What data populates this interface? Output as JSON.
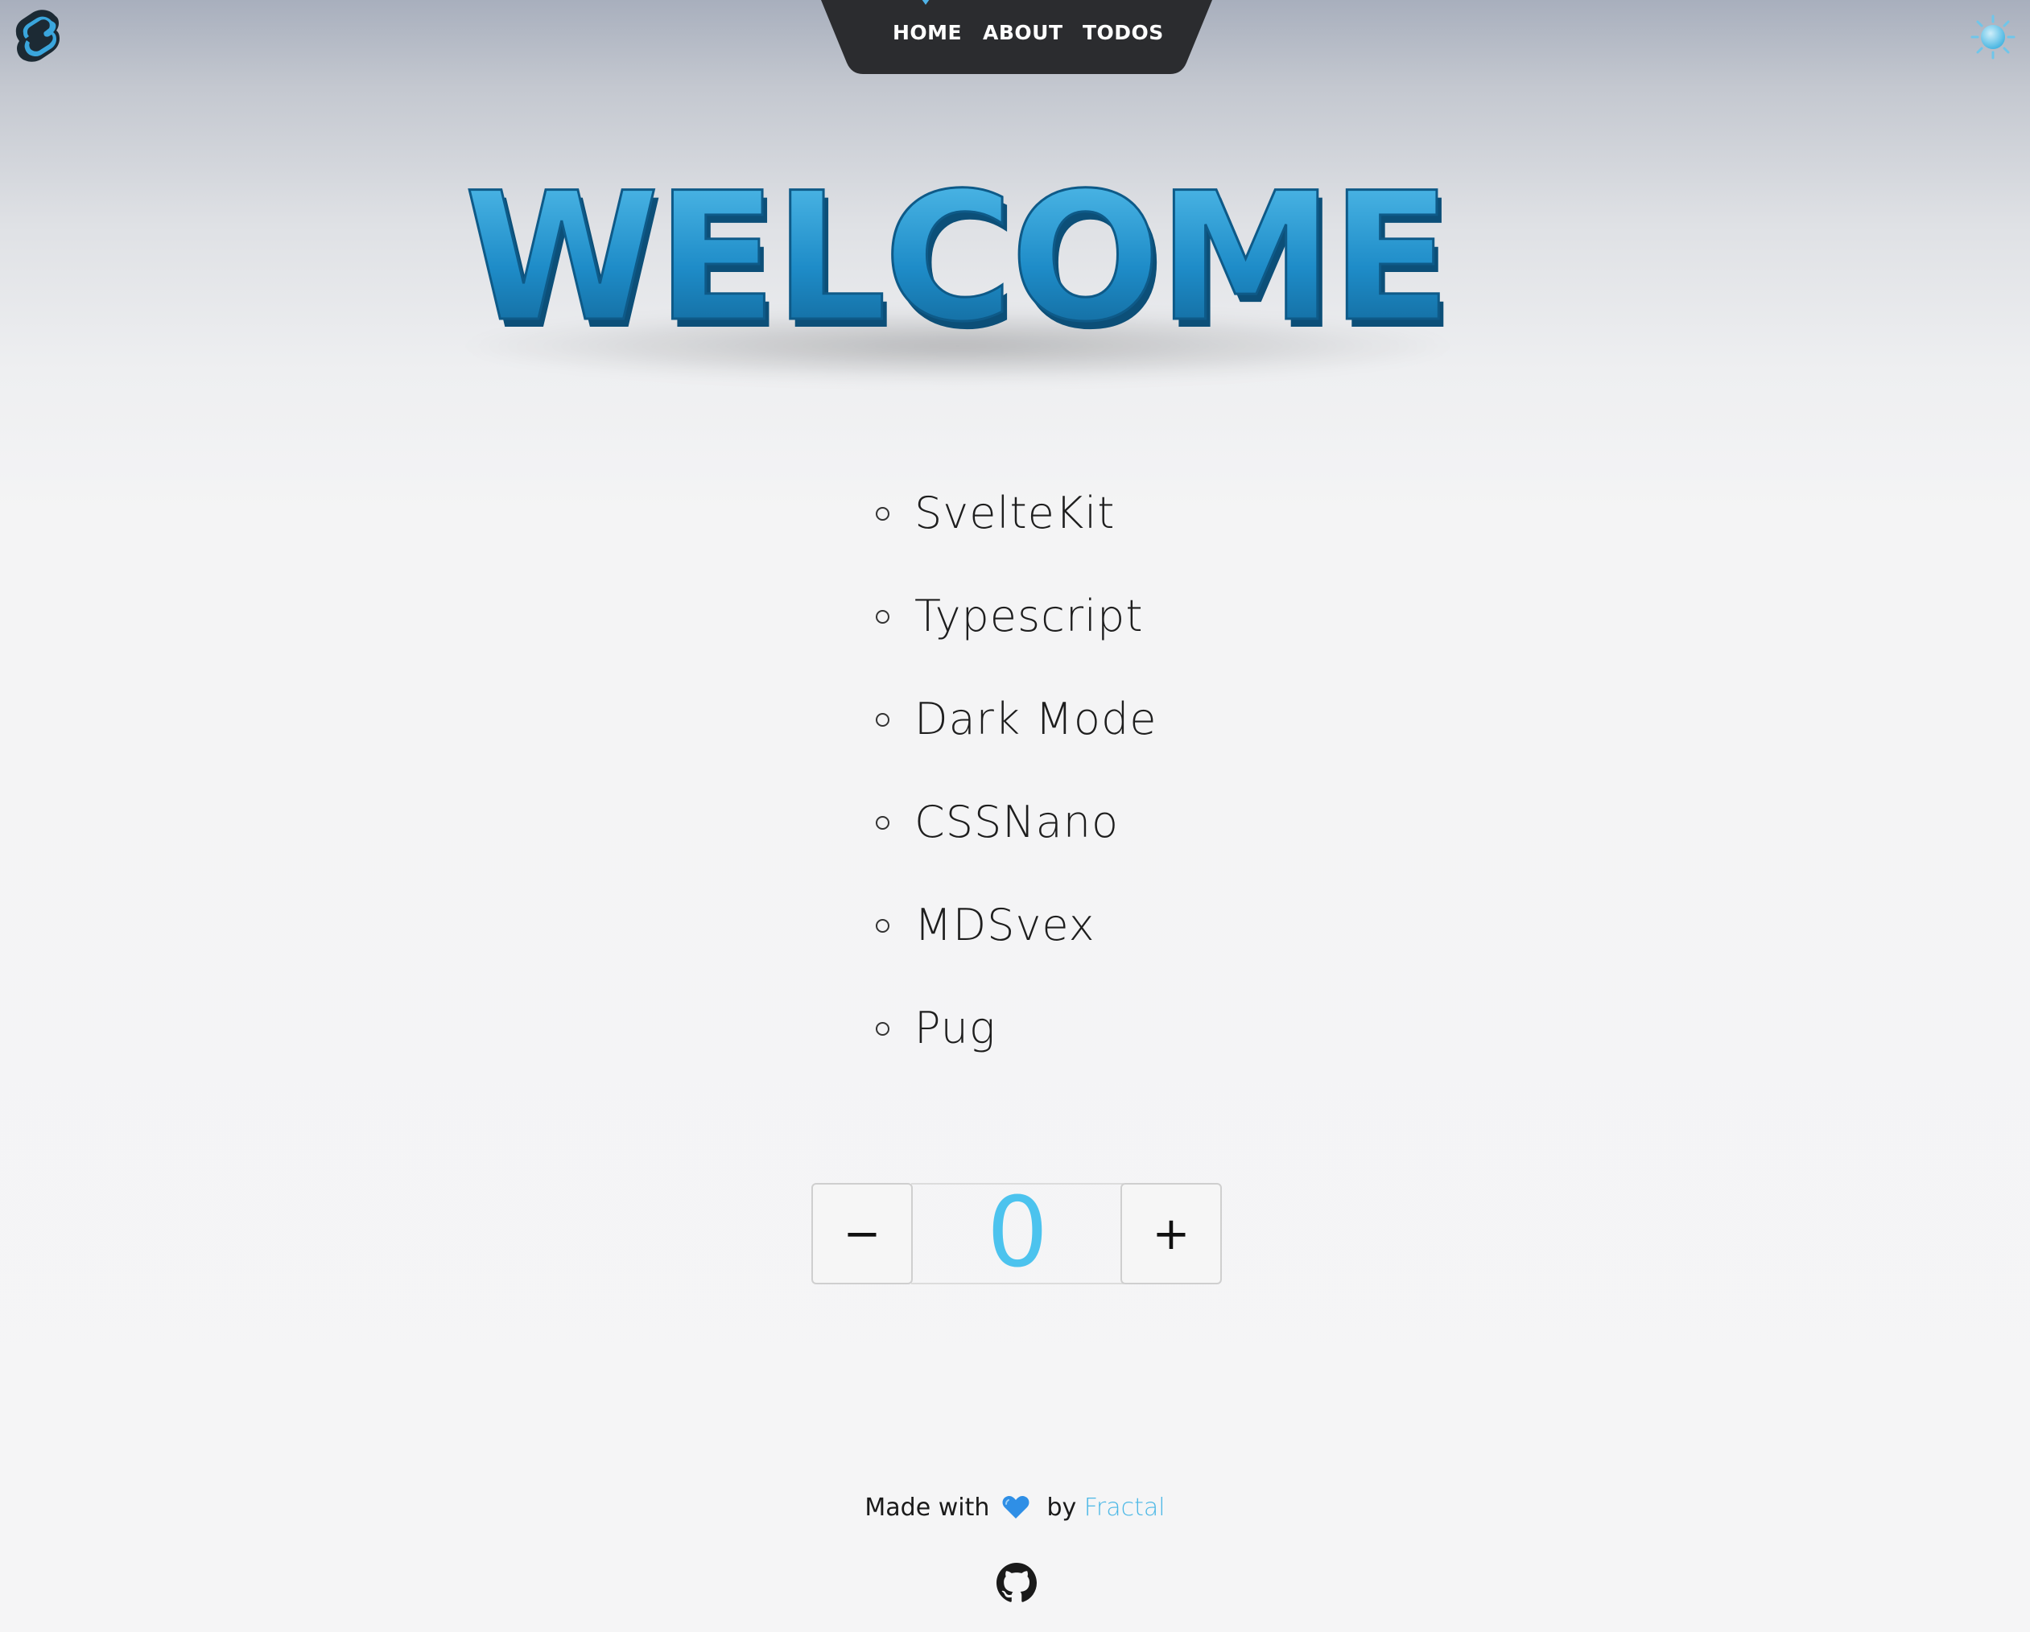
{
  "nav": {
    "items": [
      {
        "label": "HOME",
        "active": true
      },
      {
        "label": "ABOUT",
        "active": false
      },
      {
        "label": "TODOS",
        "active": false
      }
    ]
  },
  "hero": {
    "title": "WELCOME"
  },
  "features": [
    "SvelteKit",
    "Typescript",
    "Dark Mode",
    "CSSNano",
    "MDSvex",
    "Pug"
  ],
  "counter": {
    "decrement_label": "−",
    "value": "0",
    "increment_label": "+"
  },
  "footer": {
    "made_with": "Made with",
    "by": "by",
    "author_link": "Fractal"
  },
  "icons": {
    "logo": "svelte-logo-icon",
    "theme": "sun-icon",
    "heart": "blue-heart-icon",
    "github": "github-icon"
  },
  "colors": {
    "accent": "#4cc3ee",
    "nav_bg": "#2b2c2f",
    "hero_blue": "#1d8fc9",
    "link": "#4cb8e6"
  }
}
